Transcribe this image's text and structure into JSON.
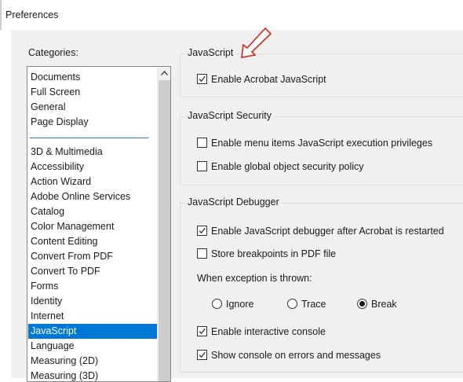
{
  "window": {
    "title": "Preferences"
  },
  "categories": {
    "label": "Categories:",
    "items": [
      {
        "label": "Documents"
      },
      {
        "label": "Full Screen"
      },
      {
        "label": "General"
      },
      {
        "label": "Page Display"
      },
      {
        "label": "3D & Multimedia"
      },
      {
        "label": "Accessibility"
      },
      {
        "label": "Action Wizard"
      },
      {
        "label": "Adobe Online Services"
      },
      {
        "label": "Catalog"
      },
      {
        "label": "Color Management"
      },
      {
        "label": "Content Editing"
      },
      {
        "label": "Convert From PDF"
      },
      {
        "label": "Convert To PDF"
      },
      {
        "label": "Forms"
      },
      {
        "label": "Identity"
      },
      {
        "label": "Internet"
      },
      {
        "label": "JavaScript",
        "selected": true
      },
      {
        "label": "Language"
      },
      {
        "label": "Measuring (2D)"
      },
      {
        "label": "Measuring (3D)"
      }
    ]
  },
  "javascript": {
    "title": "JavaScript",
    "enable_js": {
      "label": "Enable Acrobat JavaScript",
      "checked": true
    }
  },
  "security": {
    "title": "JavaScript Security",
    "menu_privileges": {
      "label": "Enable menu items JavaScript execution privileges",
      "checked": false
    },
    "global_object": {
      "label": "Enable global object security policy",
      "checked": false
    }
  },
  "debugger": {
    "title": "JavaScript Debugger",
    "enable_debugger": {
      "label": "Enable JavaScript debugger after Acrobat is restarted",
      "checked": true
    },
    "store_breakpoints": {
      "label": "Store breakpoints in PDF file",
      "checked": false
    },
    "exception_label": "When exception is thrown:",
    "exception_options": [
      {
        "label": "Ignore",
        "selected": false
      },
      {
        "label": "Trace",
        "selected": false
      },
      {
        "label": "Break",
        "selected": true
      }
    ],
    "interactive_console": {
      "label": "Enable interactive console",
      "checked": true
    },
    "console_on_errors": {
      "label": "Show console on errors and messages",
      "checked": true
    }
  },
  "annotation": {
    "arrow_color": "#e32119"
  },
  "colors": {
    "selection": "#0078d7",
    "dialog_bg": "#f0f0f0"
  }
}
